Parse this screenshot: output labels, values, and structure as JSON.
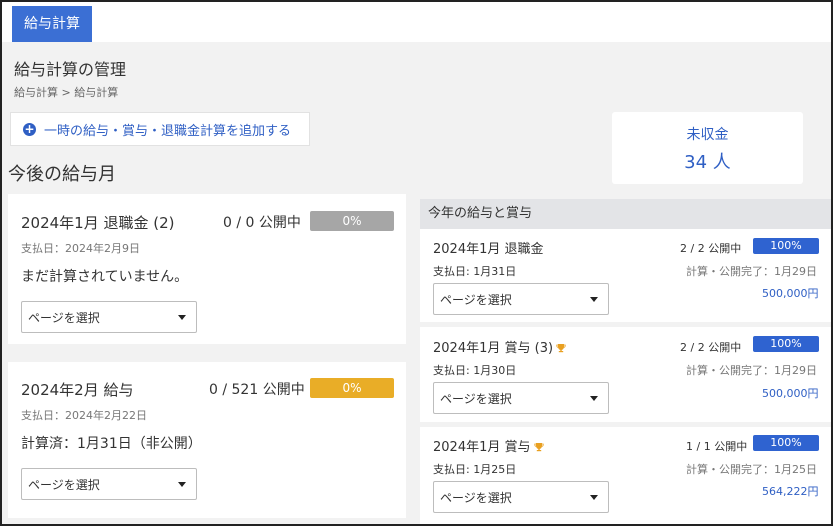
{
  "tab": {
    "label": "給与計算"
  },
  "page": {
    "title": "給与計算の管理",
    "breadcrumb": "給与計算 > 給与計算"
  },
  "add_button": {
    "label": "一時の給与・賞与・退職金計算を追加する"
  },
  "unpaid": {
    "label": "未収金",
    "count": "34 人"
  },
  "upcoming": {
    "title": "今後の給与月",
    "cards": [
      {
        "title": "2024年1月 退職金 (2)",
        "count": "0 / 0 公開中",
        "percent": "0%",
        "pay_date": "支払日：2024年2月9日",
        "status": "まだ計算されていません。",
        "select": "ページを選択",
        "bar_color": "#a6a6a6"
      },
      {
        "title": "2024年2月 給与",
        "count": "0 / 521 公開中",
        "percent": "0%",
        "pay_date": "支払日：2024年2月22日",
        "status": "計算済：1月31日（非公開）",
        "select": "ページを選択",
        "bar_color": "#e9ad27"
      }
    ]
  },
  "this_year": {
    "title": "今年の給与と賞与",
    "cards": [
      {
        "title": "2024年1月 退職金",
        "count": "2 / 2 公開中",
        "percent": "100%",
        "pay_date": "支払日: 1月31日",
        "done": "計算・公開完了：1月29日",
        "amount": "500,000円",
        "select": "ページを選択",
        "trophy": false
      },
      {
        "title": "2024年1月 賞与 (3)",
        "count": "2 / 2 公開中",
        "percent": "100%",
        "pay_date": "支払日: 1月30日",
        "done": "計算・公開完了：1月29日",
        "amount": "500,000円",
        "select": "ページを選択",
        "trophy": true
      },
      {
        "title": "2024年1月 賞与",
        "count": "1 / 1 公開中",
        "percent": "100%",
        "pay_date": "支払日: 1月25日",
        "done": "計算・公開完了：1月25日",
        "amount": "564,222円",
        "select": "ページを選択",
        "trophy": true
      }
    ]
  },
  "colors": {
    "accent": "#3b6fd4",
    "link": "#2f5fc4",
    "bar_blue": "#2f63d0"
  }
}
